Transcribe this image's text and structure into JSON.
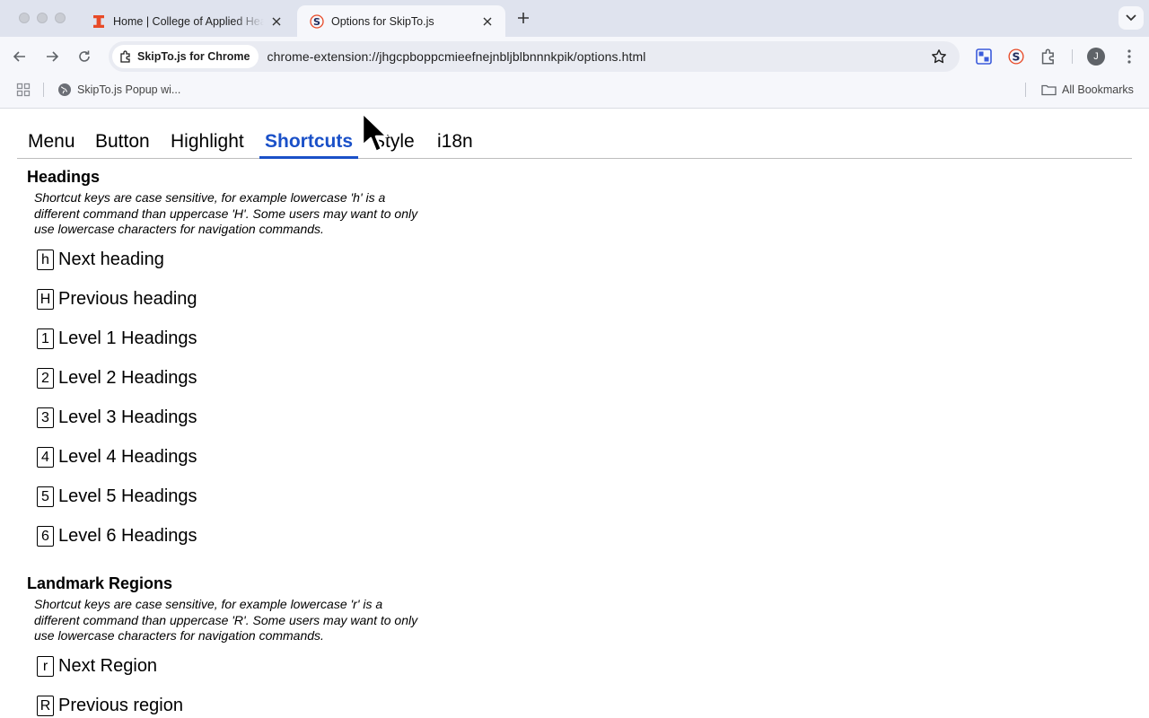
{
  "browser": {
    "tabs": [
      {
        "title": "Home | College of Applied Health Sciences",
        "favicon": "illinois-i-icon",
        "active": false
      },
      {
        "title": "Options for SkipTo.js",
        "favicon": "skipto-icon",
        "active": true
      }
    ],
    "address_chip": "SkipTo.js for Chrome",
    "url": "chrome-extension://jhgcpboppcmieefnejnbljblbnnnkpik/options.html",
    "avatar_initial": "J",
    "bookmarks": [
      {
        "label": "SkipTo.js Popup wi...",
        "icon": "globe-icon"
      }
    ],
    "all_bookmarks_label": "All Bookmarks"
  },
  "options": {
    "tabs": [
      "Menu",
      "Button",
      "Highlight",
      "Shortcuts",
      "Style",
      "i18n"
    ],
    "selected_tab": "Shortcuts",
    "headings_section": {
      "title": "Headings",
      "description": "Shortcut keys are case sensitive, for example lowercase 'h' is a different command than uppercase 'H'. Some users may want to only use lowercase characters for navigation commands.",
      "shortcuts": [
        {
          "key": "h",
          "label": "Next heading"
        },
        {
          "key": "H",
          "label": "Previous heading"
        },
        {
          "key": "1",
          "label": "Level 1 Headings"
        },
        {
          "key": "2",
          "label": "Level 2 Headings"
        },
        {
          "key": "3",
          "label": "Level 3 Headings"
        },
        {
          "key": "4",
          "label": "Level 4 Headings"
        },
        {
          "key": "5",
          "label": "Level 5 Headings"
        },
        {
          "key": "6",
          "label": "Level 6 Headings"
        }
      ]
    },
    "landmarks_section": {
      "title": "Landmark Regions",
      "description": "Shortcut keys are case sensitive, for example lowercase 'r' is a different command than uppercase 'R'. Some users may want to only use lowercase characters for navigation commands.",
      "shortcuts": [
        {
          "key": "r",
          "label": "Next Region"
        },
        {
          "key": "R",
          "label": "Previous region"
        }
      ]
    }
  },
  "colors": {
    "accent": "#1a50c8",
    "chrome_background": "#dfe3ee",
    "toolbar_background": "#f6f7fb",
    "illinois_orange": "#e84a27"
  }
}
